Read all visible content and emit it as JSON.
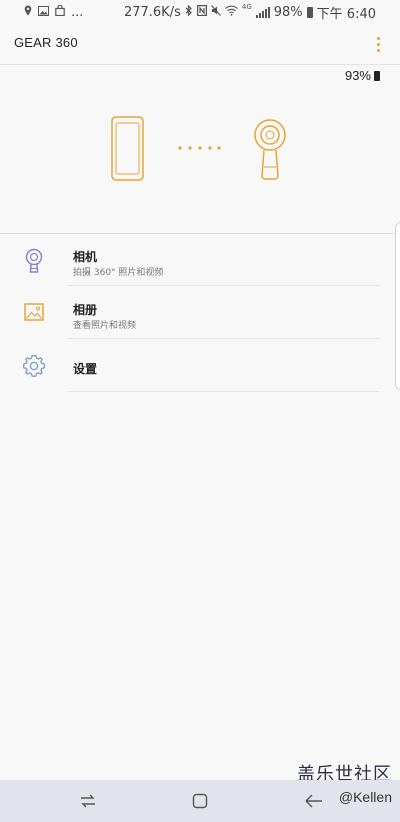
{
  "status_bar": {
    "net_speed": "277.6K/s",
    "network_type": "4G",
    "battery": "98%",
    "time": "下午 6:40",
    "more_notifications": "...",
    "left_icons": [
      "location-icon",
      "gallery-icon",
      "shopping-bag-icon"
    ],
    "right_icons": [
      "bluetooth-icon",
      "nfc-icon",
      "mute-icon",
      "wifi-icon",
      "signal-icon",
      "battery-icon"
    ]
  },
  "app_bar": {
    "title": "GEAR 360",
    "menu_icon": "more-vert-icon"
  },
  "camera_status": {
    "battery": "93%"
  },
  "illustration": {
    "phone_icon": "phone-icon",
    "camera_icon": "gear360-camera-icon"
  },
  "menu": [
    {
      "icon": "camera-icon",
      "title": "相机",
      "subtitle": "拍摄 360° 照片和视频"
    },
    {
      "icon": "album-icon",
      "title": "相册",
      "subtitle": "查看照片和视频"
    },
    {
      "icon": "settings-icon",
      "title": "设置"
    }
  ],
  "watermark": "盖乐世社区",
  "nav_bar": {
    "credit": "@Kellen",
    "buttons": [
      "recent-apps-icon",
      "home-icon",
      "back-icon"
    ]
  },
  "colors": {
    "accent": "#e5a533",
    "camera_icon": "#8a84c6",
    "settings_icon": "#7c9cc9",
    "background": "#f8f8f8",
    "nav_background": "#e3e3ee"
  }
}
